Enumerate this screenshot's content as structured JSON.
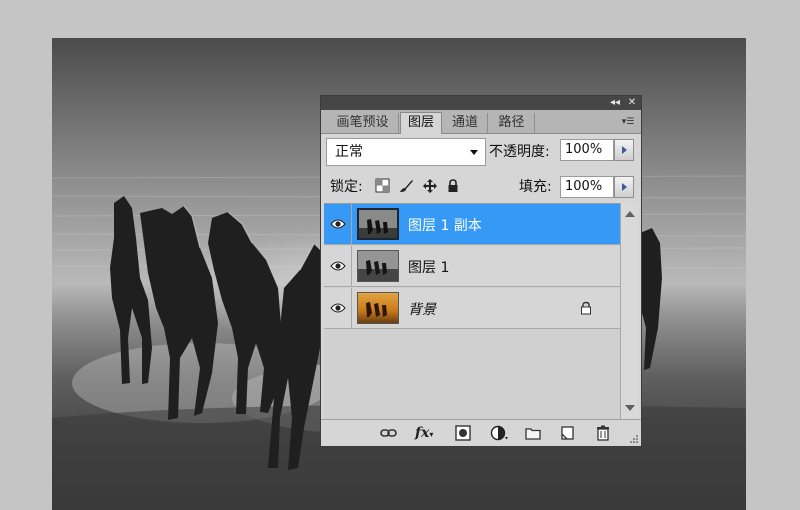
{
  "panel": {
    "tabs": [
      {
        "label": "画笔预设",
        "active": false
      },
      {
        "label": "图层",
        "active": true
      },
      {
        "label": "通道",
        "active": false
      },
      {
        "label": "路径",
        "active": false
      }
    ],
    "titlebar_icons": [
      "collapse-icon",
      "close-icon"
    ],
    "blend_mode": "正常",
    "opacity_label": "不透明度:",
    "opacity_value": "100%",
    "lock_label": "锁定:",
    "lock_icons": [
      "lock-transparent-pixels-icon",
      "lock-image-pixels-icon",
      "lock-position-icon",
      "lock-all-icon"
    ],
    "fill_label": "填充:",
    "fill_value": "100%",
    "layers": [
      {
        "name": "图层 1 副本",
        "selected": true,
        "visible": true,
        "locked": false,
        "thumbnail": "grayscale"
      },
      {
        "name": "图层 1",
        "selected": false,
        "visible": true,
        "locked": false,
        "thumbnail": "grayscale"
      },
      {
        "name": "背景",
        "selected": false,
        "visible": true,
        "locked": true,
        "thumbnail": "color"
      }
    ],
    "bottom_icons": [
      "link-layers-icon",
      "fx-icon",
      "layer-mask-icon",
      "adjustment-layer-icon",
      "group-folder-icon",
      "new-layer-icon",
      "trash-icon"
    ],
    "fx_label": "fx"
  },
  "colors": {
    "selected_row": "#3699f6",
    "panel_bg": "#d6d6d6",
    "titlebar": "#464646",
    "background_canvas": "#c5c5c5"
  }
}
